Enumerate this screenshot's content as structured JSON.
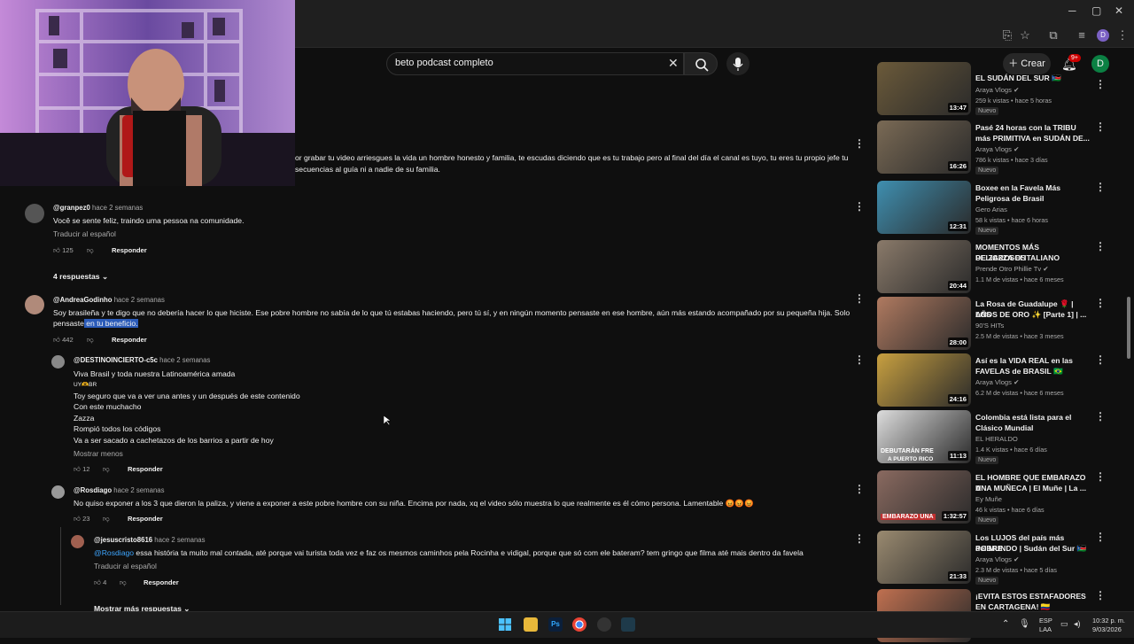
{
  "search": {
    "value": "beto podcast completo"
  },
  "header": {
    "create_label": "Crear",
    "notif_badge": "9+",
    "account_initial": "D"
  },
  "comments": {
    "partial_top": {
      "line1": "or grabar tu video arriesgues la vida un hombre honesto y familia, te escudas diciendo que es tu trabajo pero al final del día el canal es tuyo, tu eres tu propio jefe tu",
      "line2": "secuencias al guía ni a nadie de su familia."
    },
    "c1": {
      "author": "@granpez0",
      "when": "hace 2 semanas",
      "text": "Você se sente feliz, traindo uma pessoa na comunidade.",
      "translate": "Traducir al español",
      "likes": "125",
      "reply": "Responder",
      "replies_toggle": "4 respuestas"
    },
    "c2": {
      "author": "@AndreaGodinho",
      "when": "hace 2 semanas",
      "line1": "Soy brasileña y te digo que no debería hacer lo que hiciste. Ese pobre hombre no sabía de lo que tú estabas haciendo, pero tú sí, y en ningún momento pensaste en ese hombre, aún más estando acompañado por su pequeña hija. Solo",
      "line2a": "pensaste",
      "line2b": " en tu beneficio.",
      "likes": "442",
      "reply": "Responder"
    },
    "r1": {
      "author": "@DESTINOINCIERTO-c5c",
      "when": "hace 2 semanas",
      "lines": [
        "Viva Brasil y toda nuestra Latinoamérica amada",
        "UY🫶BR",
        "Toy seguro que va a ver una antes y un después de este contenido",
        "Con este muchacho",
        "Zazza",
        "Rompió todos los códigos",
        "Va a ser sacado a cachetazos de los barrios a partir de hoy"
      ],
      "show_less": "Mostrar menos",
      "likes": "12",
      "reply": "Responder"
    },
    "r2": {
      "author": "@Rosdiago",
      "when": "hace 2 semanas",
      "text": "No quiso exponer a los 3 que dieron la paliza, y viene a exponer a este pobre hombre con su niña. Encima por nada, xq el video sólo muestra lo que realmente es él cómo persona. Lamentable 😡😡😡",
      "likes": "23",
      "reply": "Responder"
    },
    "r3": {
      "author": "@jesuscristo8616",
      "when": "hace 2 semanas",
      "mention": "@Rosdiago",
      "text": " essa história ta muito mal contada, até porque vai turista toda vez e faz os mesmos caminhos pela Rocinha e vidigal, porque que só com ele bateram? tem gringo que filma até mais dentro da favela",
      "translate": "Traducir al español",
      "likes": "4",
      "reply": "Responder"
    },
    "more_replies": "Mostrar más respuestas"
  },
  "sidebar": [
    {
      "title_l1": "EL SUDÁN DEL SUR 🇸🇸",
      "title_l2": "",
      "channel": "Araya Vlogs",
      "verified": true,
      "meta": "259 k vistas • hace 5 horas",
      "badge": "Nuevo",
      "duration": "13:47",
      "color": "#6b5a3a"
    },
    {
      "title_l1": "Pasé 24 horas con la TRIBU",
      "title_l2": "más PRIMITIVA en SUDÁN DE...",
      "channel": "Araya Vlogs",
      "verified": true,
      "meta": "786 k vistas • hace 3 días",
      "badge": "Nuevo",
      "duration": "16:26",
      "color": "#7a6a55"
    },
    {
      "title_l1": "Boxee en la Favela Más",
      "title_l2": "Peligrosa de Brasil",
      "channel": "Gero Arias",
      "verified": false,
      "meta": "58 k vistas • hace 6 horas",
      "badge": "Nuevo",
      "duration": "12:31",
      "color": "#3f8fb0"
    },
    {
      "title_l1": "MOMENTOS MÁS PELIGROSOS",
      "title_l2": "DE ZAZZA El ITALIANO",
      "channel": "Prende Otro Phillie Tv",
      "verified": true,
      "meta": "1.1 M de vistas • hace 6 meses",
      "badge": "",
      "duration": "20:44",
      "color": "#8a7a6a"
    },
    {
      "title_l1": "La Rosa de Guadalupe 🌹 | LOS",
      "title_l2": "AÑOS DE ORO ✨ [Parte 1] | ...",
      "channel": "90'S HITs",
      "verified": false,
      "meta": "2.5 M de vistas • hace 3 meses",
      "badge": "",
      "duration": "28:00",
      "color": "#b07a60"
    },
    {
      "title_l1": "Así es la VIDA REAL en las",
      "title_l2": "FAVELAS de BRASIL 🇧🇷",
      "channel": "Araya Vlogs",
      "verified": true,
      "meta": "6.2 M de vistas • hace 6 meses",
      "badge": "",
      "duration": "24:16",
      "color": "#c8a040"
    },
    {
      "title_l1": "Colombia está lista para el",
      "title_l2": "Clásico Mundial",
      "channel": "EL HERALDO",
      "verified": false,
      "meta": "1.4 K vistas • hace 6 días",
      "badge": "Nuevo",
      "duration": "11:13",
      "color": "#ddd"
    },
    {
      "title_l1": "EL HOMBRE QUE EMBARAZO A",
      "title_l2": "UNA MUÑECA | El Muñe | La ...",
      "channel": "Ey Muñe",
      "verified": false,
      "meta": "46 k vistas • hace 6 días",
      "badge": "Nuevo",
      "duration": "1:32:57",
      "color": "#8a6a60"
    },
    {
      "title_l1": "Los LUJOS del país más POBRE",
      "title_l2": "del MUNDO | Sudán del Sur 🇸🇸",
      "channel": "Araya Vlogs",
      "verified": true,
      "meta": "2.3 M de vistas • hace 5 días",
      "badge": "Nuevo",
      "duration": "21:33",
      "color": "#9a8a70"
    },
    {
      "title_l1": "¡EVITA ESTOS ESTAFADORES",
      "title_l2": "EN CARTAGENA! 🇨🇴",
      "channel": "",
      "verified": false,
      "meta": "",
      "badge": "",
      "duration": "",
      "color": "#c07050"
    }
  ],
  "thumb_overlays": {
    "colombia": "DEBUTARÁN FRE",
    "colombia2": "A PUERTO RICO",
    "muneca": "EMBARAZO UNA"
  },
  "taskbar": {
    "lang1": "ESP",
    "lang2": "LAA",
    "time": "10:32 p. m.",
    "date": "9/03/2026"
  }
}
